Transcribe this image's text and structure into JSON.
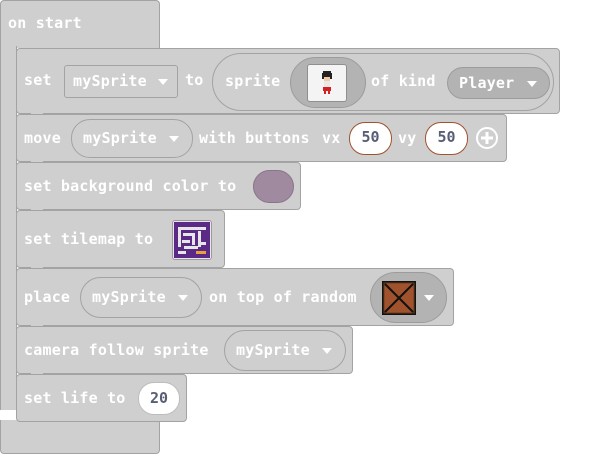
{
  "event": {
    "label": "on start"
  },
  "set_sprite": {
    "set_label": "set",
    "variable": "mySprite",
    "to_label": "to",
    "sprite_label": "sprite",
    "of_kind_label": "of kind",
    "kind": "Player"
  },
  "move": {
    "label": "move",
    "variable": "mySprite",
    "with_buttons_label": "with buttons",
    "vx_label": "vx",
    "vx_value": "50",
    "vy_label": "vy",
    "vy_value": "50"
  },
  "background": {
    "label": "set background color to",
    "color": "#a08aa0"
  },
  "tilemap": {
    "label": "set tilemap to"
  },
  "place": {
    "label": "place",
    "variable": "mySprite",
    "on_top_label": "on top of random"
  },
  "camera": {
    "label": "camera follow sprite",
    "variable": "mySprite"
  },
  "life": {
    "label": "set life to",
    "value": "20"
  },
  "colors": {
    "block": "#cfcfcf",
    "block_border": "#a3a3a3",
    "field_text": "#575e75",
    "number_border": "#a0522d"
  }
}
